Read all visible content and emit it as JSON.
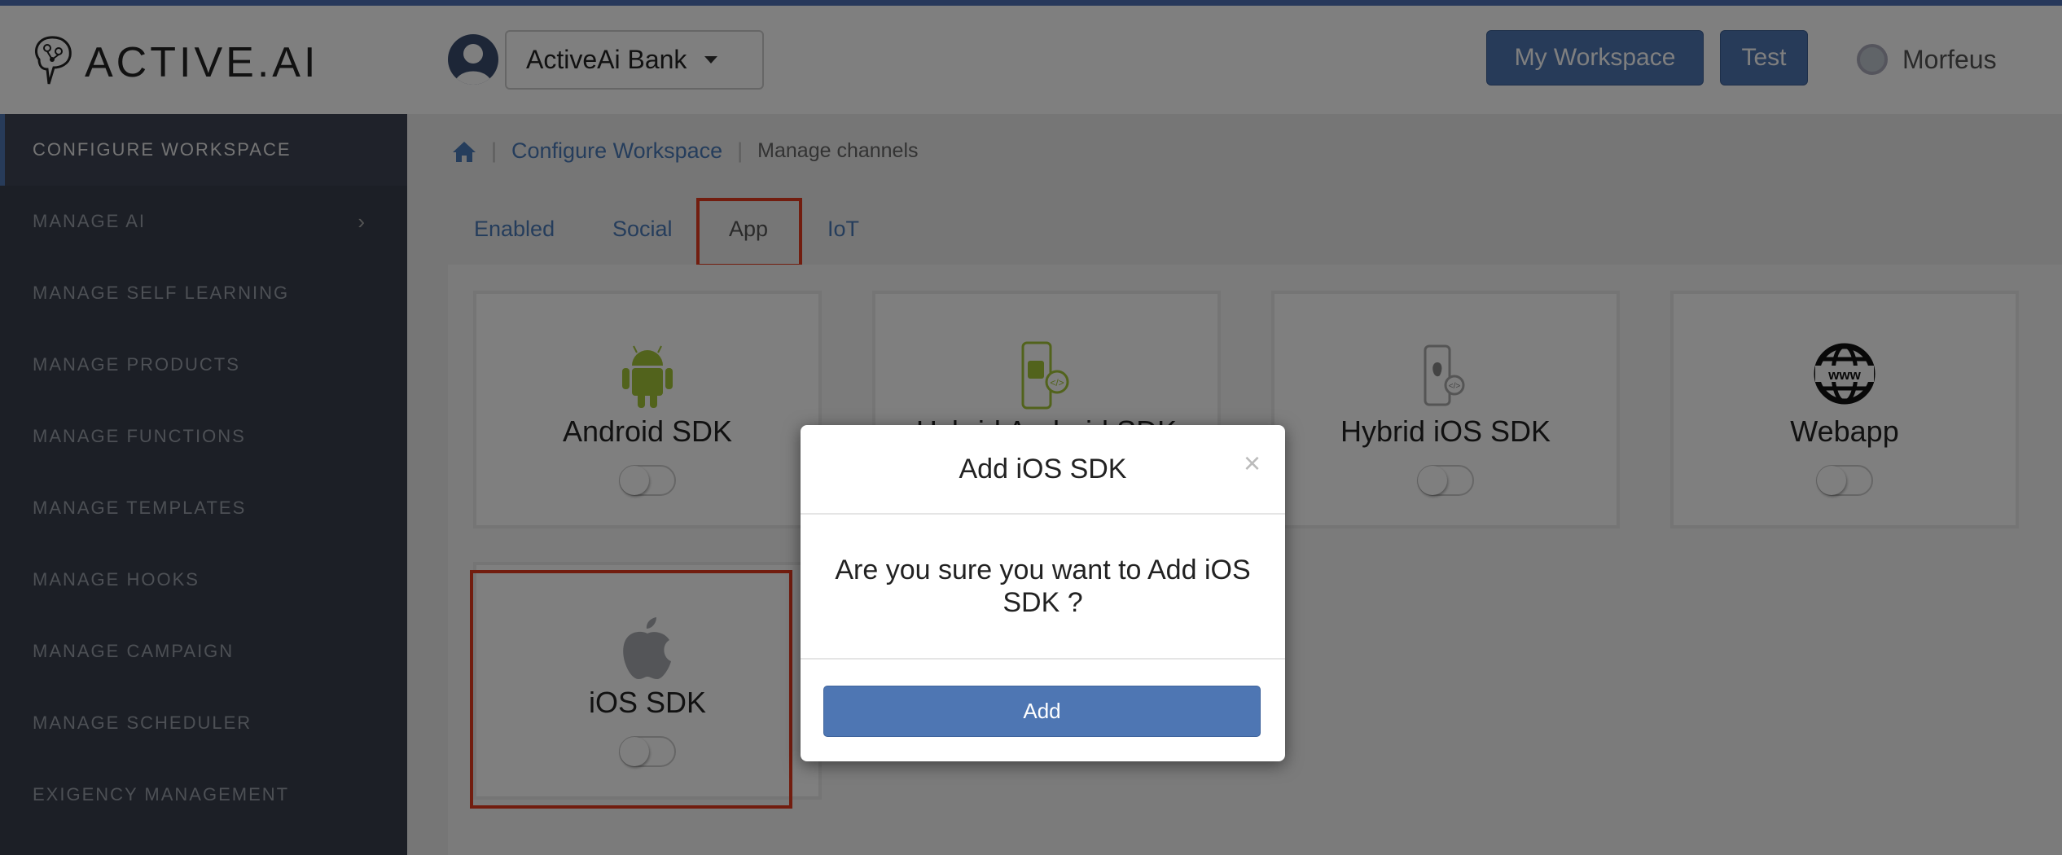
{
  "header": {
    "logo_text": "ACTIVE.AI",
    "workspace_selector": "ActiveAi Bank",
    "my_workspace": "My Workspace",
    "test": "Test",
    "user": "Morfeus"
  },
  "sidebar": {
    "items": [
      {
        "label": "CONFIGURE WORKSPACE"
      },
      {
        "label": "MANAGE AI"
      },
      {
        "label": "MANAGE SELF LEARNING"
      },
      {
        "label": "MANAGE PRODUCTS"
      },
      {
        "label": "MANAGE FUNCTIONS"
      },
      {
        "label": "MANAGE TEMPLATES"
      },
      {
        "label": "MANAGE HOOKS"
      },
      {
        "label": "MANAGE CAMPAIGN"
      },
      {
        "label": "MANAGE SCHEDULER"
      },
      {
        "label": "EXIGENCY MANAGEMENT"
      }
    ]
  },
  "breadcrumb": {
    "link": "Configure Workspace",
    "current": "Manage channels"
  },
  "tabs": [
    {
      "label": "Enabled"
    },
    {
      "label": "Social"
    },
    {
      "label": "App",
      "selected": true
    },
    {
      "label": "IoT"
    }
  ],
  "channels": [
    {
      "label": "Android SDK",
      "icon": "android-icon",
      "enabled": false
    },
    {
      "label": "Hybrid Android SDK",
      "icon": "hybrid-android-icon",
      "enabled": false
    },
    {
      "label": "Hybrid iOS SDK",
      "icon": "hybrid-ios-icon",
      "enabled": false
    },
    {
      "label": "Webapp",
      "icon": "www-globe-icon",
      "enabled": false
    },
    {
      "label": "iOS SDK",
      "icon": "apple-icon",
      "enabled": false
    }
  ],
  "modal": {
    "title": "Add iOS SDK",
    "close": "×",
    "message": "Are you sure you want to Add iOS SDK ?",
    "add": "Add"
  },
  "colors": {
    "accent": "#4e76b3",
    "highlight": "#e53a1e",
    "sidebar": "#383e4c"
  }
}
